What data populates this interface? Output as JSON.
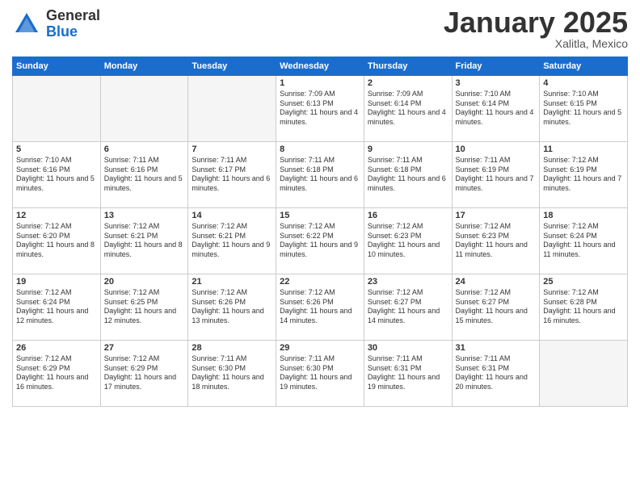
{
  "header": {
    "logo_general": "General",
    "logo_blue": "Blue",
    "month": "January 2025",
    "location": "Xalitla, Mexico"
  },
  "days_of_week": [
    "Sunday",
    "Monday",
    "Tuesday",
    "Wednesday",
    "Thursday",
    "Friday",
    "Saturday"
  ],
  "weeks": [
    [
      {
        "day": "",
        "empty": true
      },
      {
        "day": "",
        "empty": true
      },
      {
        "day": "",
        "empty": true
      },
      {
        "day": "1",
        "sunrise": "7:09 AM",
        "sunset": "6:13 PM",
        "daylight": "11 hours and 4 minutes."
      },
      {
        "day": "2",
        "sunrise": "7:09 AM",
        "sunset": "6:14 PM",
        "daylight": "11 hours and 4 minutes."
      },
      {
        "day": "3",
        "sunrise": "7:10 AM",
        "sunset": "6:14 PM",
        "daylight": "11 hours and 4 minutes."
      },
      {
        "day": "4",
        "sunrise": "7:10 AM",
        "sunset": "6:15 PM",
        "daylight": "11 hours and 5 minutes."
      }
    ],
    [
      {
        "day": "5",
        "sunrise": "7:10 AM",
        "sunset": "6:16 PM",
        "daylight": "11 hours and 5 minutes."
      },
      {
        "day": "6",
        "sunrise": "7:11 AM",
        "sunset": "6:16 PM",
        "daylight": "11 hours and 5 minutes."
      },
      {
        "day": "7",
        "sunrise": "7:11 AM",
        "sunset": "6:17 PM",
        "daylight": "11 hours and 6 minutes."
      },
      {
        "day": "8",
        "sunrise": "7:11 AM",
        "sunset": "6:18 PM",
        "daylight": "11 hours and 6 minutes."
      },
      {
        "day": "9",
        "sunrise": "7:11 AM",
        "sunset": "6:18 PM",
        "daylight": "11 hours and 6 minutes."
      },
      {
        "day": "10",
        "sunrise": "7:11 AM",
        "sunset": "6:19 PM",
        "daylight": "11 hours and 7 minutes."
      },
      {
        "day": "11",
        "sunrise": "7:12 AM",
        "sunset": "6:19 PM",
        "daylight": "11 hours and 7 minutes."
      }
    ],
    [
      {
        "day": "12",
        "sunrise": "7:12 AM",
        "sunset": "6:20 PM",
        "daylight": "11 hours and 8 minutes."
      },
      {
        "day": "13",
        "sunrise": "7:12 AM",
        "sunset": "6:21 PM",
        "daylight": "11 hours and 8 minutes."
      },
      {
        "day": "14",
        "sunrise": "7:12 AM",
        "sunset": "6:21 PM",
        "daylight": "11 hours and 9 minutes."
      },
      {
        "day": "15",
        "sunrise": "7:12 AM",
        "sunset": "6:22 PM",
        "daylight": "11 hours and 9 minutes."
      },
      {
        "day": "16",
        "sunrise": "7:12 AM",
        "sunset": "6:23 PM",
        "daylight": "11 hours and 10 minutes."
      },
      {
        "day": "17",
        "sunrise": "7:12 AM",
        "sunset": "6:23 PM",
        "daylight": "11 hours and 11 minutes."
      },
      {
        "day": "18",
        "sunrise": "7:12 AM",
        "sunset": "6:24 PM",
        "daylight": "11 hours and 11 minutes."
      }
    ],
    [
      {
        "day": "19",
        "sunrise": "7:12 AM",
        "sunset": "6:24 PM",
        "daylight": "11 hours and 12 minutes."
      },
      {
        "day": "20",
        "sunrise": "7:12 AM",
        "sunset": "6:25 PM",
        "daylight": "11 hours and 12 minutes."
      },
      {
        "day": "21",
        "sunrise": "7:12 AM",
        "sunset": "6:26 PM",
        "daylight": "11 hours and 13 minutes."
      },
      {
        "day": "22",
        "sunrise": "7:12 AM",
        "sunset": "6:26 PM",
        "daylight": "11 hours and 14 minutes."
      },
      {
        "day": "23",
        "sunrise": "7:12 AM",
        "sunset": "6:27 PM",
        "daylight": "11 hours and 14 minutes."
      },
      {
        "day": "24",
        "sunrise": "7:12 AM",
        "sunset": "6:27 PM",
        "daylight": "11 hours and 15 minutes."
      },
      {
        "day": "25",
        "sunrise": "7:12 AM",
        "sunset": "6:28 PM",
        "daylight": "11 hours and 16 minutes."
      }
    ],
    [
      {
        "day": "26",
        "sunrise": "7:12 AM",
        "sunset": "6:29 PM",
        "daylight": "11 hours and 16 minutes."
      },
      {
        "day": "27",
        "sunrise": "7:12 AM",
        "sunset": "6:29 PM",
        "daylight": "11 hours and 17 minutes."
      },
      {
        "day": "28",
        "sunrise": "7:11 AM",
        "sunset": "6:30 PM",
        "daylight": "11 hours and 18 minutes."
      },
      {
        "day": "29",
        "sunrise": "7:11 AM",
        "sunset": "6:30 PM",
        "daylight": "11 hours and 19 minutes."
      },
      {
        "day": "30",
        "sunrise": "7:11 AM",
        "sunset": "6:31 PM",
        "daylight": "11 hours and 19 minutes."
      },
      {
        "day": "31",
        "sunrise": "7:11 AM",
        "sunset": "6:31 PM",
        "daylight": "11 hours and 20 minutes."
      },
      {
        "day": "",
        "empty": true
      }
    ]
  ]
}
